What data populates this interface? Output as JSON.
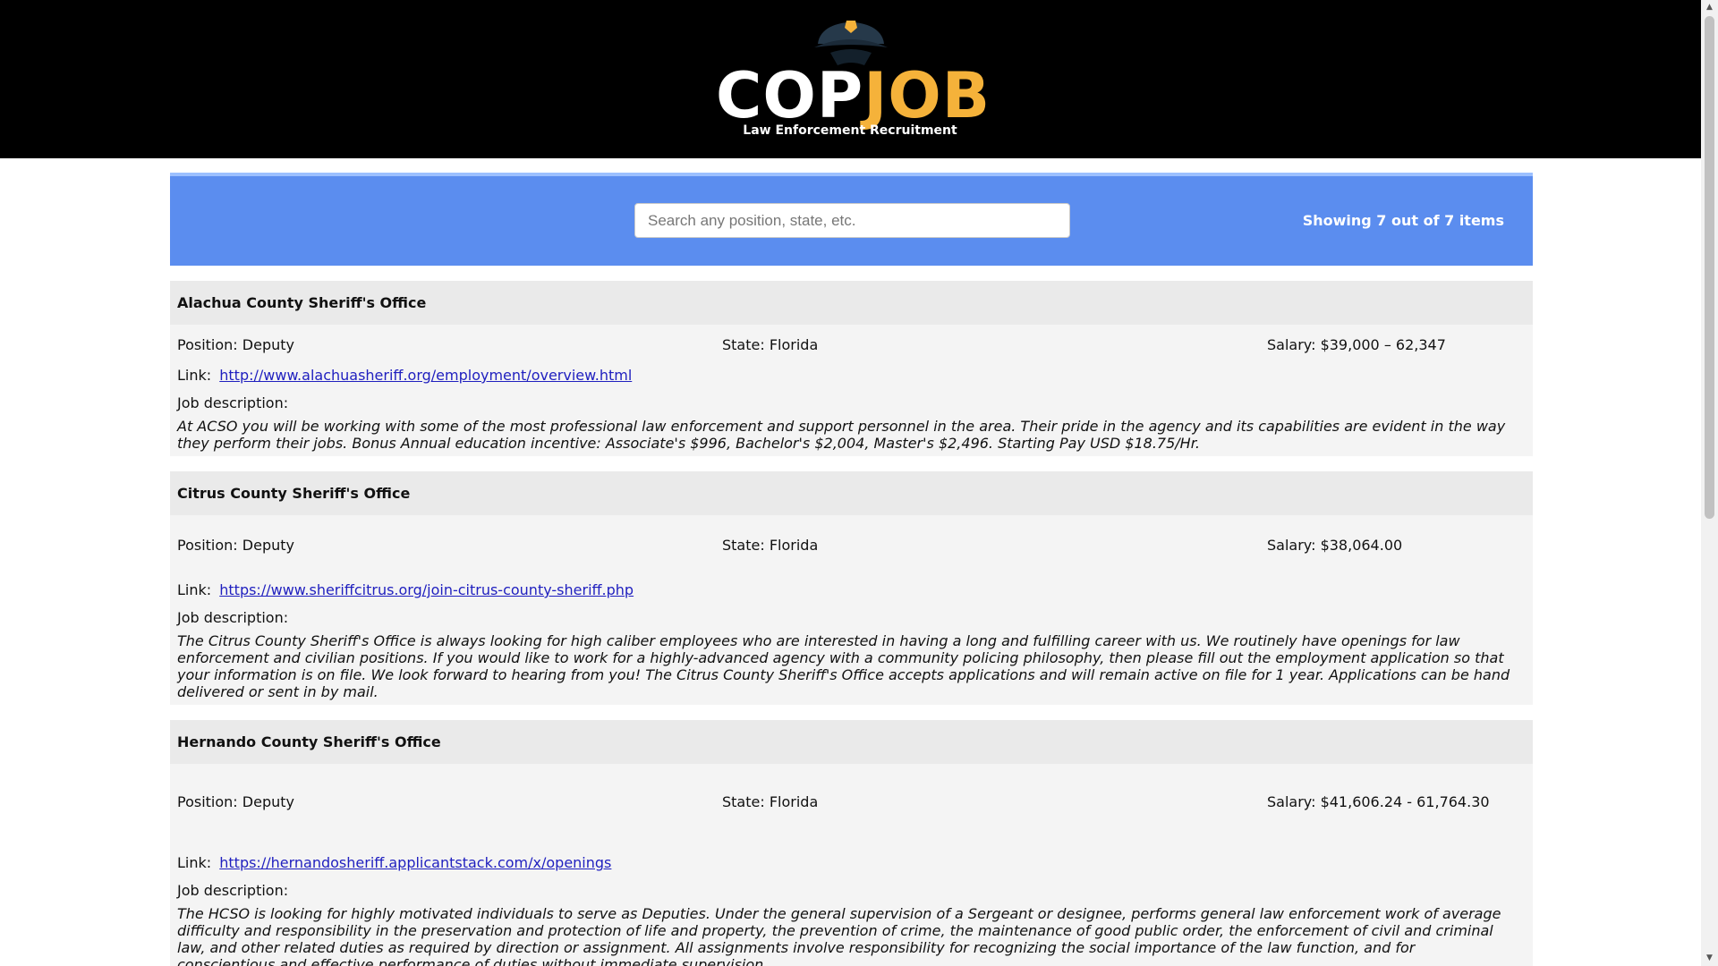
{
  "brand": {
    "word_cop": "COP",
    "word_job": "JOB",
    "tagline": "Law Enforcement Recruitment",
    "accent_color": "#f5b23a",
    "icon": "police-cap-icon"
  },
  "search": {
    "placeholder": "Search any position, state, etc.",
    "value": "",
    "showing_text": "Showing 7 out of 7 items",
    "panel_color": "#5b8def"
  },
  "jobs": [
    {
      "agency": "Alachua County Sheriff's Office",
      "position_label": "Position: Deputy",
      "state_label": "State: Florida",
      "salary_label": "Salary: $39,000 – 62,347",
      "link_label": "Link:",
      "link": "http://www.alachuasheriff.org/employment/overview.html",
      "desc_label": "Job description:",
      "description": "At ACSO you will be working with some of the most professional law enforcement and support personnel in the area. Their pride in the agency and its capabilities are evident in the way they perform their jobs. Bonus Annual education incentive: Associate's $996, Bachelor's $2,004, Master's $2,496. Starting Pay USD $18.75/Hr."
    },
    {
      "agency": "Citrus County Sheriff's Office",
      "position_label": "Position: Deputy",
      "state_label": "State: Florida",
      "salary_label": "Salary: $38,064.00",
      "link_label": "Link:",
      "link": "https://www.sheriffcitrus.org/join-citrus-county-sheriff.php",
      "desc_label": "Job description:",
      "description": "The Citrus County Sheriff's Office is always looking for high caliber employees who are interested in having a long and fulfilling career with us. We routinely have openings for law enforcement and civilian positions. If you would like to work for a highly-advanced agency with a community policing philosophy, then please fill out the employment application so that your information is on file. We look forward to hearing from you! The Citrus County Sheriff's Office accepts applications and will remain active on file for 1 year. Applications can be hand delivered or sent in by mail."
    },
    {
      "agency": "Hernando County Sheriff's Office",
      "position_label": "Position: Deputy",
      "state_label": "State: Florida",
      "salary_label": "Salary: $41,606.24 - 61,764.30",
      "link_label": "Link:",
      "link": "https://hernandosheriff.applicantstack.com/x/openings",
      "desc_label": "Job description:",
      "description": "The HCSO is looking for highly motivated individuals to serve as Deputies. Under the general supervision of a Sergeant or designee, performs general law enforcement work of average difficulty and responsibility in the preservation and protection of life and property, the prevention of crime, the maintenance of good public order, the enforcement of civil and criminal law, and other related duties as required by direction or assignment. All assignments involve responsibility for recognizing the social importance of the law function, and for conscientious and effective performance of duties without immediate supervision."
    }
  ]
}
